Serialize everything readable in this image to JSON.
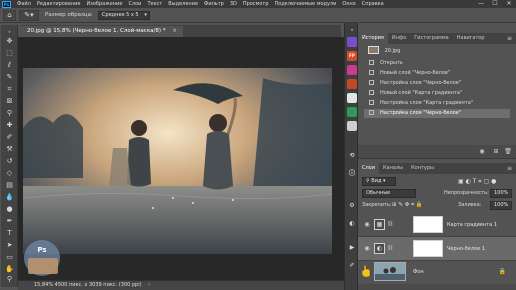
{
  "app": {
    "logo": "Ps"
  },
  "menu": [
    "Файл",
    "Редактирование",
    "Изображение",
    "Слои",
    "Текст",
    "Выделение",
    "Фильтр",
    "3D",
    "Просмотр",
    "Подключаемые модули",
    "Окно",
    "Справка"
  ],
  "window_controls": {
    "minimize": "—",
    "maximize": "☐",
    "close": "✕"
  },
  "options_bar": {
    "home_icon": "home-icon",
    "tool_icon": "eyedropper-icon",
    "sample_size_label": "Размер образца:",
    "sample_size_value": "Среднее 5 х 5"
  },
  "document_tab": {
    "title": "20.jpg @ 15,8% (Черно-белое 1, Слой-маска/8) *",
    "close": "×"
  },
  "status_bar": {
    "text": "15,84%     4500 пикс. х 3039 пикс. (300 ppi)",
    "arrow": "›"
  },
  "history_panel": {
    "tabs": [
      "История",
      "Инфо",
      "Гистограмма",
      "Навигатор"
    ],
    "active_tab": "История",
    "snapshot_label": "20.jpg",
    "items": [
      {
        "label": "Открыть",
        "selected": false
      },
      {
        "label": "Новый слой \"Черно-белое\"",
        "selected": false
      },
      {
        "label": "Настройка слоя \"Черно-белое\"",
        "selected": false
      },
      {
        "label": "Новый слой \"Карта градиента\"",
        "selected": false
      },
      {
        "label": "Настройка слоя \"Карта градиента\"",
        "selected": false
      },
      {
        "label": "Настройка слоя \"Черно-белое\"",
        "selected": true
      }
    ]
  },
  "layers_panel": {
    "tabs": [
      "Слои",
      "Каналы",
      "Контуры"
    ],
    "active_tab": "Слои",
    "filter_label": "Вид",
    "blend_mode": "Обычные",
    "opacity_label": "Непрозрачность:",
    "opacity_value": "100%",
    "lock_label": "Закрепить:",
    "fill_label": "Заливка:",
    "fill_value": "100%",
    "layers": [
      {
        "name": "Карта градиента 1",
        "type": "adjustment",
        "selected": false
      },
      {
        "name": "Черно-белое 1",
        "type": "adjustment",
        "selected": true
      },
      {
        "name": "Фон",
        "type": "background",
        "selected": false
      }
    ]
  },
  "colors": {
    "menubar": "#393939",
    "panel": "#535353",
    "selected_row": "#6e6e6e",
    "ps_blue": "#31a8ff"
  }
}
